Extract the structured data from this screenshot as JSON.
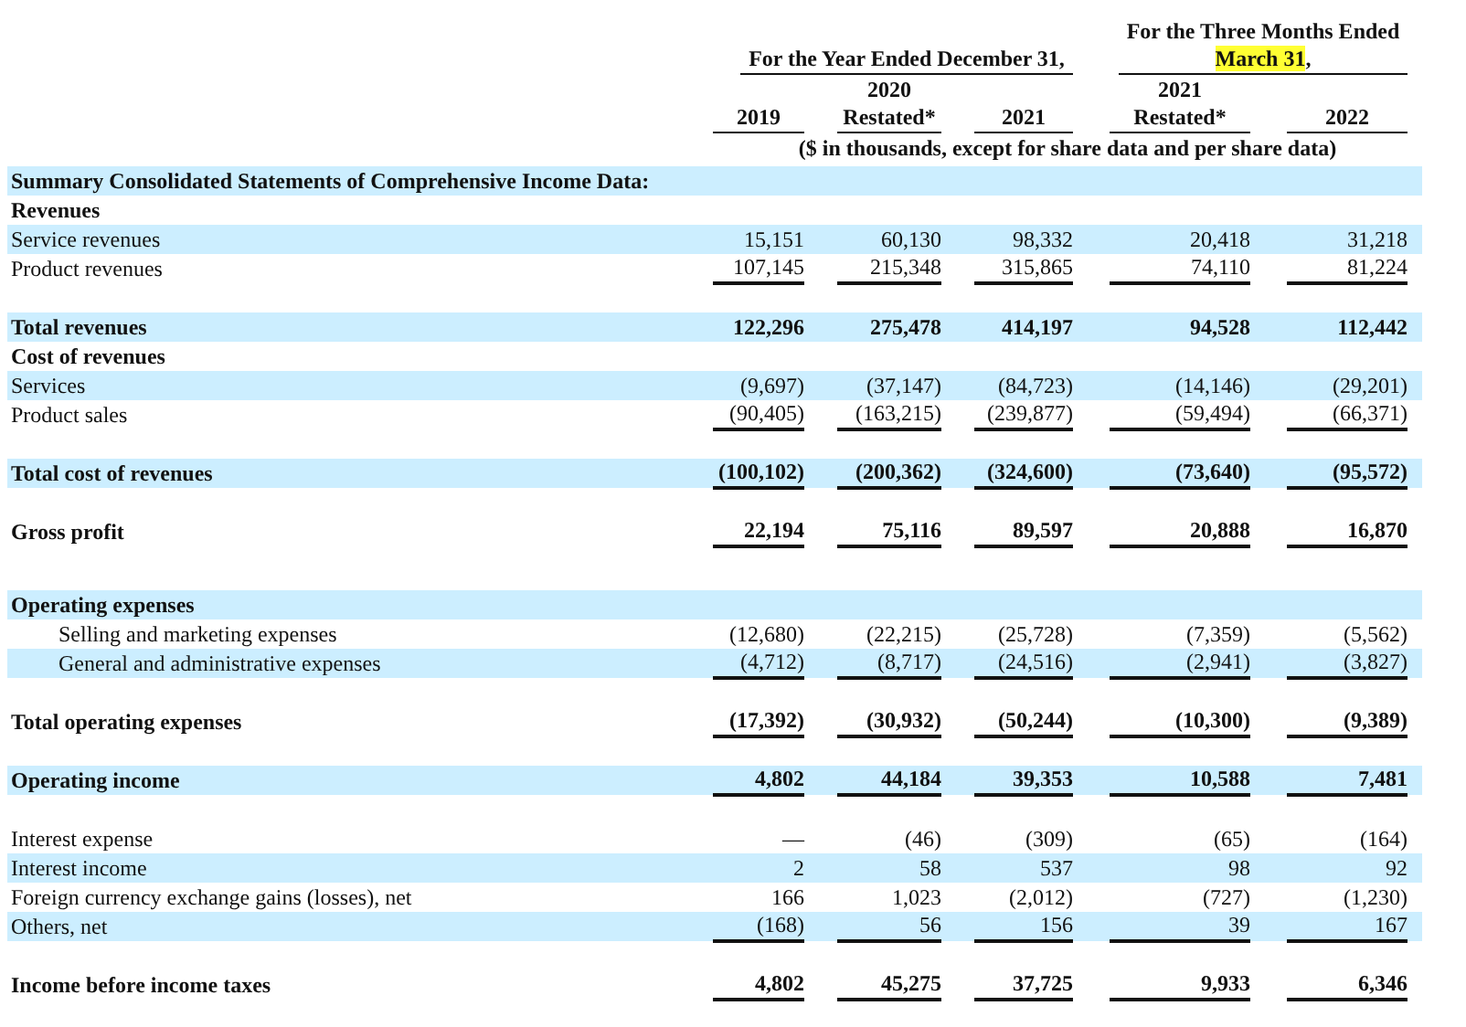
{
  "header": {
    "groups": [
      {
        "lines": [
          [
            {
              "text": "For the Year Ended December 31,",
              "highlighted": false
            }
          ]
        ]
      },
      {
        "lines": [
          [
            {
              "text": "For the Three Months Ended",
              "highlighted": false
            }
          ],
          [
            {
              "text": "March 31",
              "highlighted": true
            },
            {
              "text": ",",
              "highlighted": false
            }
          ]
        ]
      }
    ],
    "columns": [
      [
        "2019"
      ],
      [
        "2020",
        "Restated*"
      ],
      [
        "2021"
      ],
      [
        "2021",
        "Restated*"
      ],
      [
        "2022"
      ]
    ],
    "units": "($ in thousands, except for share data and per share data)"
  },
  "sections": [
    [
      {
        "kind": "heading",
        "label": "Summary Consolidated Statements of Comprehensive Income Data:"
      },
      {
        "kind": "heading",
        "label": "Revenues"
      },
      {
        "kind": "item",
        "label": "Service revenues",
        "values": [
          "15,151",
          "60,130",
          "98,332",
          "20,418",
          "31,218"
        ],
        "underlined": false
      },
      {
        "kind": "item",
        "label": "Product revenues",
        "values": [
          "107,145",
          "215,348",
          "315,865",
          "74,110",
          "81,224"
        ],
        "underlined": true
      }
    ],
    [
      {
        "kind": "total",
        "label": "Total revenues",
        "values": [
          "122,296",
          "275,478",
          "414,197",
          "94,528",
          "112,442"
        ],
        "underlined": false
      },
      {
        "kind": "heading",
        "label": "Cost of revenues"
      },
      {
        "kind": "item",
        "label": "Services",
        "values": [
          "(9,697)",
          "(37,147)",
          "(84,723)",
          "(14,146)",
          "(29,201)"
        ],
        "underlined": false
      },
      {
        "kind": "item",
        "label": "Product sales",
        "values": [
          "(90,405)",
          "(163,215)",
          "(239,877)",
          "(59,494)",
          "(66,371)"
        ],
        "underlined": true
      }
    ],
    [
      {
        "kind": "total",
        "label": "Total cost of revenues",
        "values": [
          "(100,102)",
          "(200,362)",
          "(324,600)",
          "(73,640)",
          "(95,572)"
        ],
        "underlined": true
      }
    ],
    [
      {
        "kind": "total",
        "label": "Gross profit",
        "values": [
          "22,194",
          "75,116",
          "89,597",
          "20,888",
          "16,870"
        ],
        "underlined": true
      }
    ],
    [
      {
        "kind": "heading",
        "label": "Operating expenses"
      },
      {
        "kind": "subitem",
        "label": "Selling and marketing expenses",
        "values": [
          "(12,680)",
          "(22,215)",
          "(25,728)",
          "(7,359)",
          "(5,562)"
        ],
        "underlined": false
      },
      {
        "kind": "subitem",
        "label": "General and administrative expenses",
        "values": [
          "(4,712)",
          "(8,717)",
          "(24,516)",
          "(2,941)",
          "(3,827)"
        ],
        "underlined": true
      }
    ],
    [
      {
        "kind": "total",
        "label": "Total operating expenses",
        "values": [
          "(17,392)",
          "(30,932)",
          "(50,244)",
          "(10,300)",
          "(9,389)"
        ],
        "underlined": true
      }
    ],
    [
      {
        "kind": "total",
        "label": "Operating income",
        "values": [
          "4,802",
          "44,184",
          "39,353",
          "10,588",
          "7,481"
        ],
        "underlined": true
      }
    ],
    [
      {
        "kind": "item",
        "label": "Interest expense",
        "values": [
          "—",
          "(46)",
          "(309)",
          "(65)",
          "(164)"
        ],
        "underlined": false
      },
      {
        "kind": "item",
        "label": "Interest income",
        "values": [
          "2",
          "58",
          "537",
          "98",
          "92"
        ],
        "underlined": false
      },
      {
        "kind": "item",
        "label": "Foreign currency exchange gains (losses), net",
        "values": [
          "166",
          "1,023",
          "(2,012)",
          "(727)",
          "(1,230)"
        ],
        "underlined": false
      },
      {
        "kind": "item",
        "label": "Others, net",
        "values": [
          "(168)",
          "56",
          "156",
          "39",
          "167"
        ],
        "underlined": true
      }
    ],
    [
      {
        "kind": "total",
        "label": "Income before income taxes",
        "values": [
          "4,802",
          "45,275",
          "37,725",
          "9,933",
          "6,346"
        ],
        "underlined": true
      }
    ]
  ]
}
